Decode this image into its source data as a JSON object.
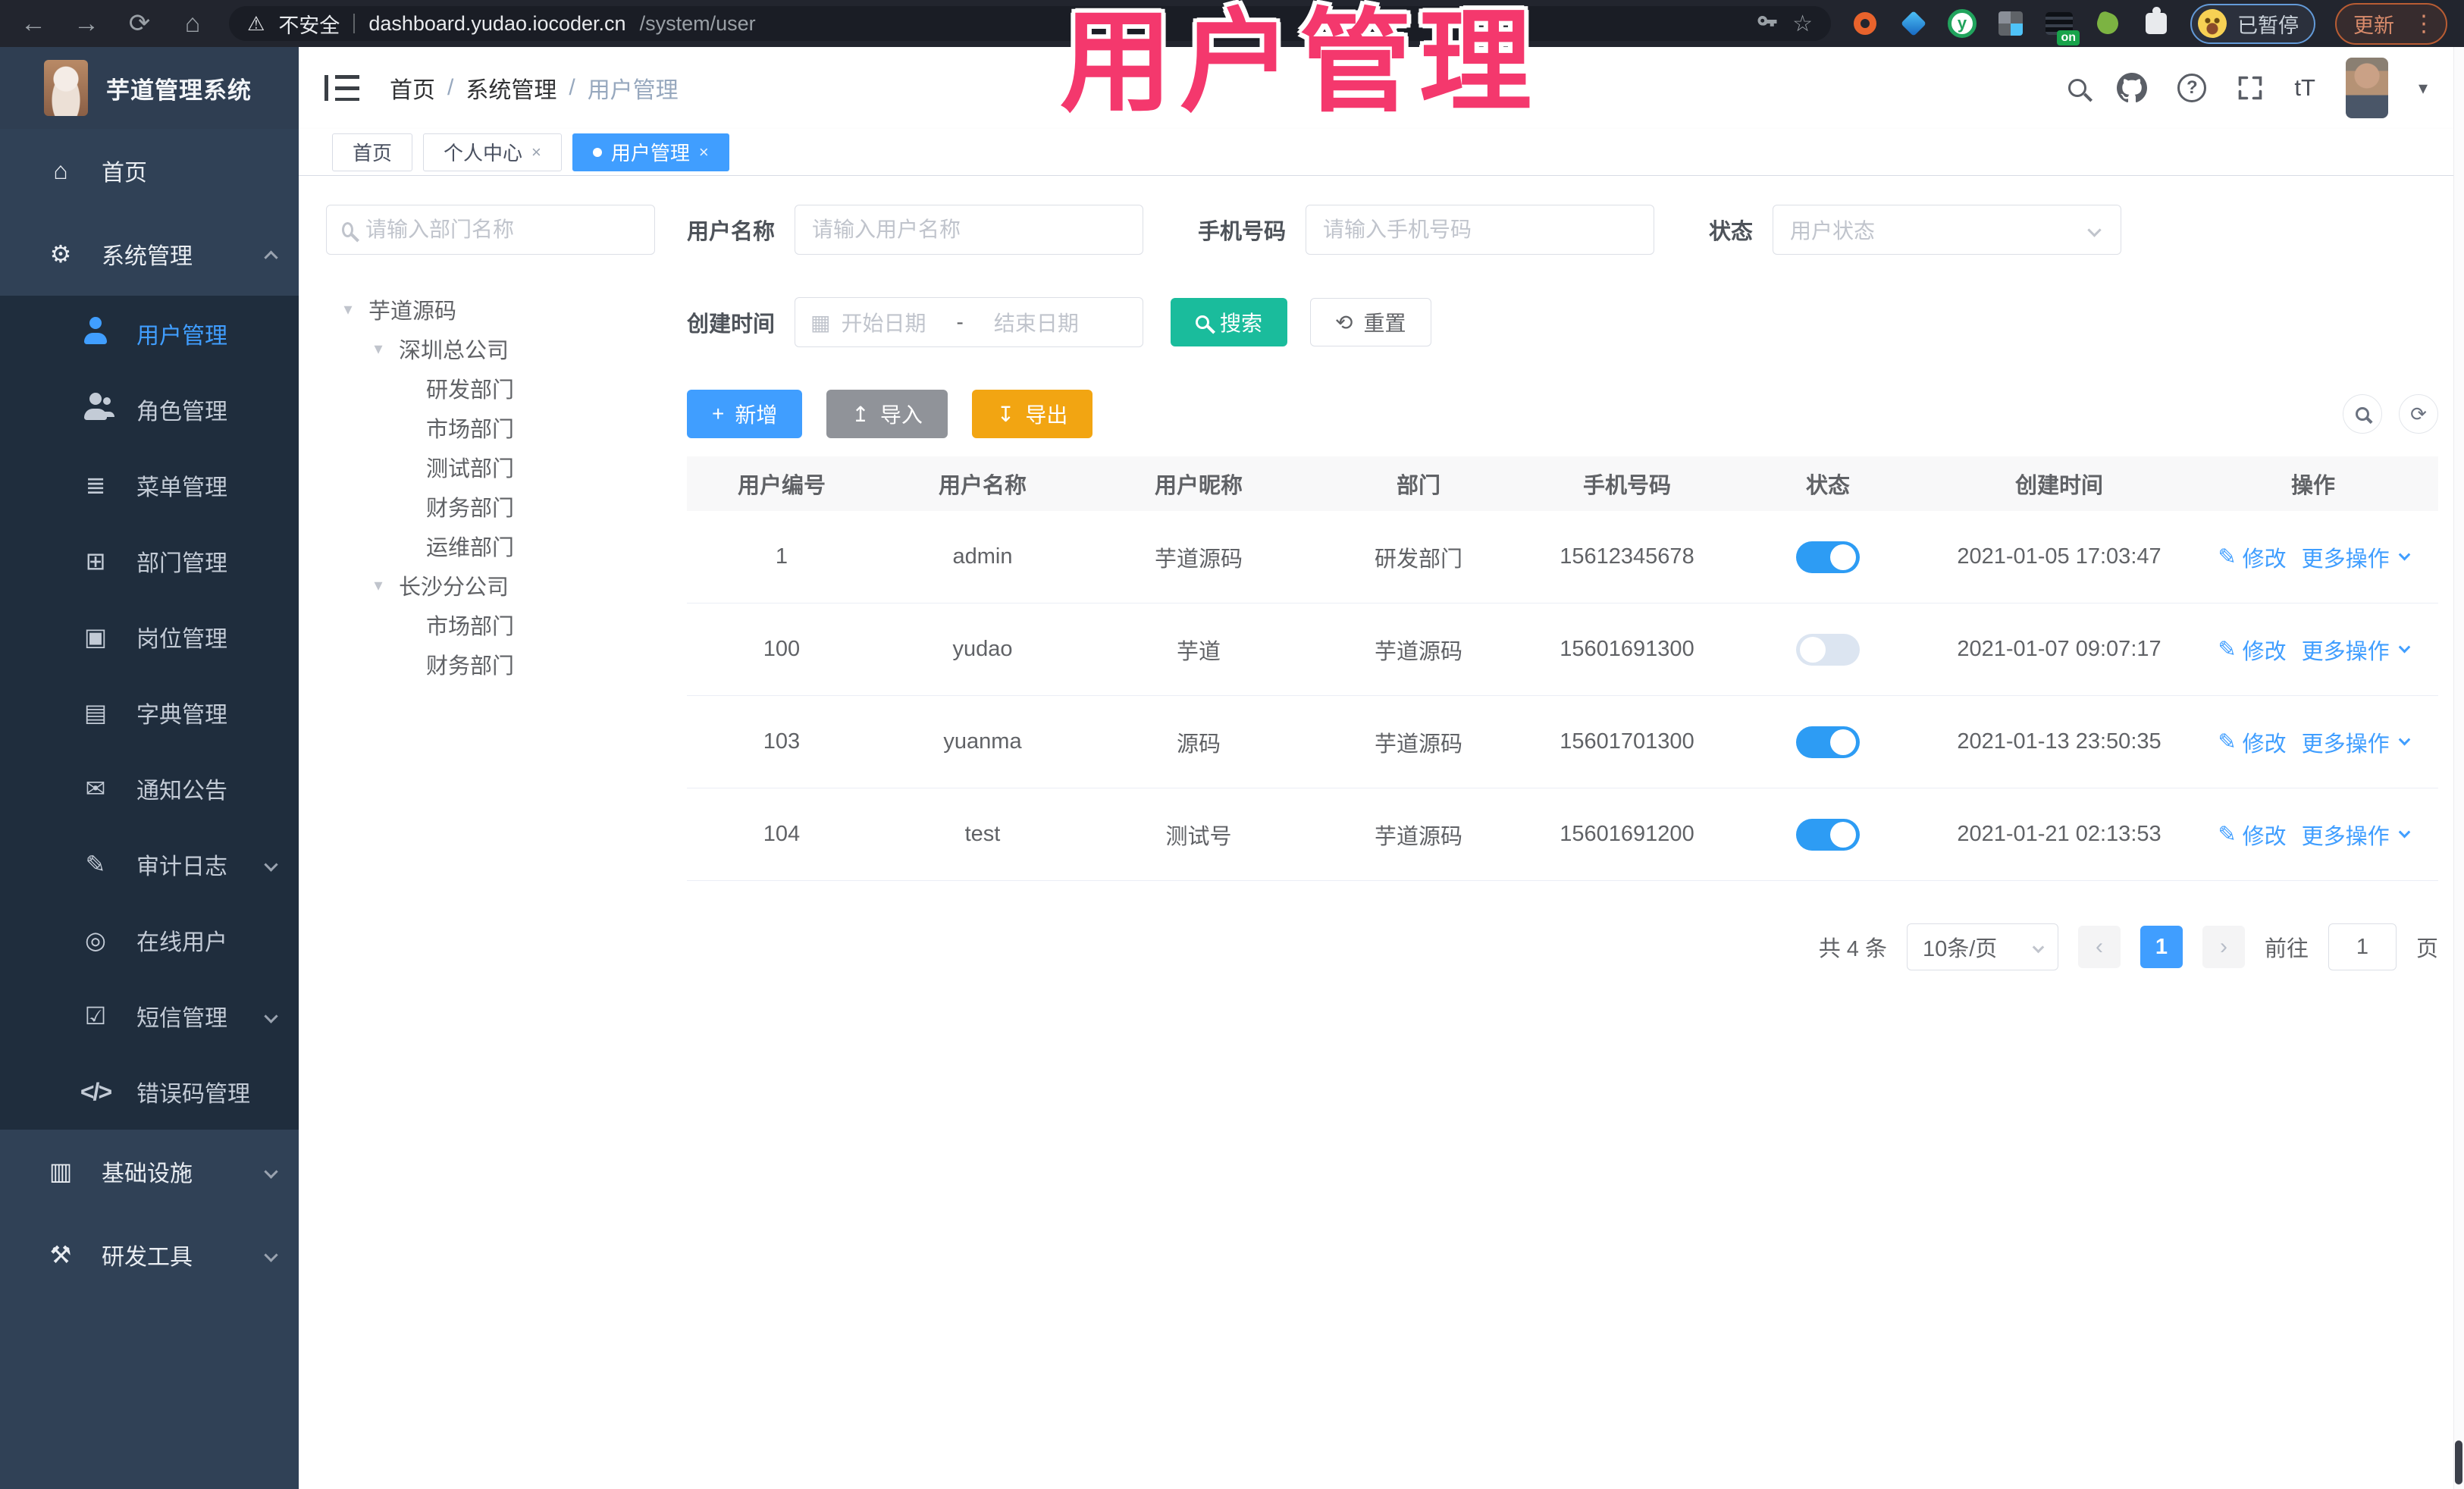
{
  "colors": {
    "accent": "#409EFF",
    "search_teal": "#1ABC9C",
    "export_orange": "#F2A512",
    "sidebar_bg": "#304156",
    "submenu_bg": "#1f2d3d",
    "watermark_pink": "#F4386D"
  },
  "browser": {
    "security_label": "不安全",
    "url_host": "dashboard.yudao.iocoder.cn",
    "url_path": "/system/user",
    "ext_on_badge": "on",
    "ext_y_label": "y",
    "paused_label": "已暂停",
    "update_label": "更新"
  },
  "watermark": "用户管理",
  "header": {
    "app_title": "芋道管理系统",
    "breadcrumb": {
      "home": "首页",
      "section": "系统管理",
      "current": "用户管理"
    },
    "font_icon_label": "tT"
  },
  "tabs": {
    "home": "首页",
    "profile": "个人中心",
    "current": "用户管理"
  },
  "sidebar": {
    "home": "首页",
    "system": "系统管理",
    "children": [
      "用户管理",
      "角色管理",
      "菜单管理",
      "部门管理",
      "岗位管理",
      "字典管理",
      "通知公告",
      "审计日志",
      "在线用户",
      "短信管理",
      "错误码管理"
    ],
    "infra": "基础设施",
    "devtools": "研发工具"
  },
  "dept": {
    "search_placeholder": "请输入部门名称",
    "nodes": [
      "芋道源码",
      "深圳总公司",
      "研发部门",
      "市场部门",
      "测试部门",
      "财务部门",
      "运维部门",
      "长沙分公司",
      "市场部门",
      "财务部门"
    ]
  },
  "filters": {
    "username_label": "用户名称",
    "username_placeholder": "请输入用户名称",
    "mobile_label": "手机号码",
    "mobile_placeholder": "请输入手机号码",
    "status_label": "状态",
    "status_placeholder": "用户状态",
    "time_label": "创建时间",
    "date_start": "开始日期",
    "date_sep": "-",
    "date_end": "结束日期",
    "search_label": "搜索",
    "reset_label": "重置"
  },
  "toolbar": {
    "add_label": "新增",
    "import_label": "导入",
    "export_label": "导出"
  },
  "table": {
    "columns": [
      "用户编号",
      "用户名称",
      "用户昵称",
      "部门",
      "手机号码",
      "状态",
      "创建时间",
      "操作"
    ],
    "edit_label": "修改",
    "more_label": "更多操作",
    "rows": [
      {
        "id": "1",
        "username": "admin",
        "nickname": "芋道源码",
        "dept": "研发部门",
        "mobile": "15612345678",
        "status_on": true,
        "created": "2021-01-05 17:03:47"
      },
      {
        "id": "100",
        "username": "yudao",
        "nickname": "芋道",
        "dept": "芋道源码",
        "mobile": "15601691300",
        "status_on": false,
        "created": "2021-01-07 09:07:17"
      },
      {
        "id": "103",
        "username": "yuanma",
        "nickname": "源码",
        "dept": "芋道源码",
        "mobile": "15601701300",
        "status_on": true,
        "created": "2021-01-13 23:50:35"
      },
      {
        "id": "104",
        "username": "test",
        "nickname": "测试号",
        "dept": "芋道源码",
        "mobile": "15601691200",
        "status_on": true,
        "created": "2021-01-21 02:13:53"
      }
    ]
  },
  "pagination": {
    "total": "共 4 条",
    "page_size": "10条/页",
    "page": "1",
    "goto_label": "前往",
    "goto_value": "1",
    "unit_label": "页"
  }
}
